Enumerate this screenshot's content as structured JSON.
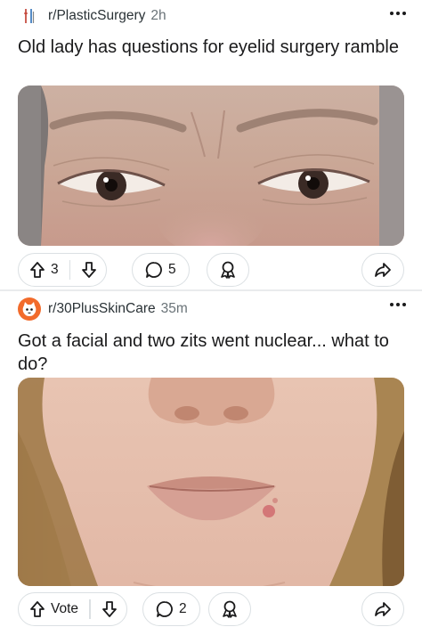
{
  "posts": [
    {
      "subreddit": "r/PlasticSurgery",
      "subreddit_icon": "tools-icon",
      "time": "2h",
      "title": "Old lady has questions for eyelid surgery ramble",
      "image": "eyes-closeup-photo",
      "votes": "3",
      "comments": "5"
    },
    {
      "subreddit": "r/30PlusSkinCare",
      "subreddit_icon": "cat-icon",
      "subreddit_icon_color": "#f26b2b",
      "time": "35m",
      "title": "Got a facial and two zits went nuclear... what to do?",
      "image": "chin-mouth-closeup-photo",
      "votes": "Vote",
      "comments": "2"
    }
  ],
  "icons": {
    "upvote": "arrow-up-icon",
    "downvote": "arrow-down-icon",
    "comment": "comment-bubble-icon",
    "award": "award-icon",
    "share": "share-arrow-icon",
    "more": "more-dots-icon"
  },
  "colors": {
    "border": "#dbe0e3",
    "muted_text": "#6a7378",
    "separator": "#e9ebed"
  }
}
